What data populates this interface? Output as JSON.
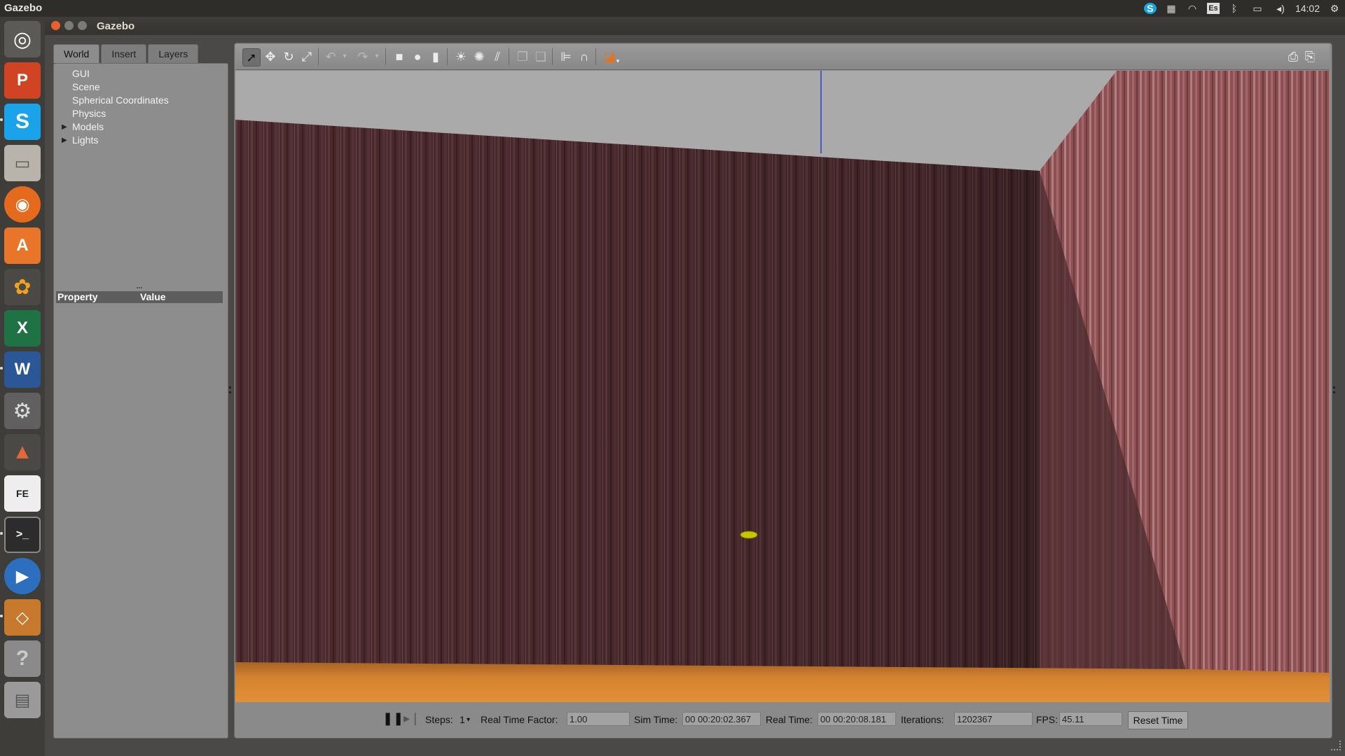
{
  "system_bar": {
    "app_name": "Gazebo",
    "keyboard_layout": "Es",
    "clock": "14:02",
    "icons": [
      "skype-tray-icon",
      "workspaces-icon",
      "wifi-icon",
      "keyboard-icon",
      "bluetooth-icon",
      "battery-icon",
      "volume-icon",
      "settings-gear-icon"
    ]
  },
  "launcher": {
    "items": [
      "ubuntu-dash",
      "powerpoint",
      "skype",
      "files",
      "firefox",
      "software-center",
      "system-app",
      "excel",
      "word",
      "system-settings",
      "matlab",
      "pdf-editor",
      "terminal",
      "video-player",
      "gazebo",
      "help",
      "removable-drive"
    ]
  },
  "window": {
    "title": "Gazebo"
  },
  "left_panel": {
    "tabs": [
      "World",
      "Insert",
      "Layers"
    ],
    "active_tab": "World",
    "tree": [
      {
        "label": "GUI",
        "expandable": false
      },
      {
        "label": "Scene",
        "expandable": false
      },
      {
        "label": "Spherical Coordinates",
        "expandable": false
      },
      {
        "label": "Physics",
        "expandable": false
      },
      {
        "label": "Models",
        "expandable": true
      },
      {
        "label": "Lights",
        "expandable": true
      }
    ],
    "property_header": {
      "property": "Property",
      "value": "Value"
    }
  },
  "toolbar": {
    "tools": [
      "select-tool",
      "translate-tool",
      "rotate-tool",
      "scale-tool",
      "undo",
      "undo-dropdown",
      "redo",
      "redo-dropdown",
      "box-shape",
      "sphere-shape",
      "cylinder-shape",
      "point-light",
      "spot-light",
      "directional-light",
      "copy",
      "paste",
      "align",
      "snap",
      "view-angle"
    ],
    "right_tools": [
      "screenshot",
      "record-log"
    ]
  },
  "bottom_bar": {
    "steps_label": "Steps:",
    "steps_value": "1",
    "rtf_label": "Real Time Factor:",
    "rtf_value": "1.00",
    "sim_time_label": "Sim Time:",
    "sim_time_value": "00 00:20:02.367",
    "real_time_label": "Real Time:",
    "real_time_value": "00 00:20:08.181",
    "iterations_label": "Iterations:",
    "iterations_value": "1202367",
    "fps_label": "FPS:",
    "fps_value": "45.11",
    "reset_label": "Reset Time"
  },
  "colors": {
    "left_wall": "#4a2a2c",
    "right_wall": "#8c4f52",
    "floor": "#c87832",
    "sky": "#aaaaaa",
    "ball": "#c9c400"
  }
}
